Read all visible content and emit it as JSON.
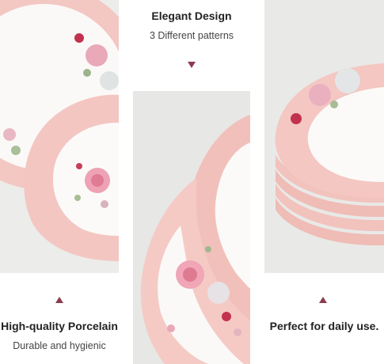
{
  "sections": {
    "top": {
      "title": "Elegant Design",
      "subtitle": "3 Different patterns"
    },
    "left": {
      "title": "High-quality Porcelain",
      "subtitle": "Durable and hygienic"
    },
    "right": {
      "title": "Perfect for daily use."
    }
  },
  "colors": {
    "pink_rim": "#f2c2bd",
    "rose": "#e88aa0",
    "accent_arrow": "#8a3d4c"
  },
  "icons": {
    "arrow_top": "triangle-down",
    "arrow_left": "triangle-up",
    "arrow_right": "triangle-up"
  }
}
